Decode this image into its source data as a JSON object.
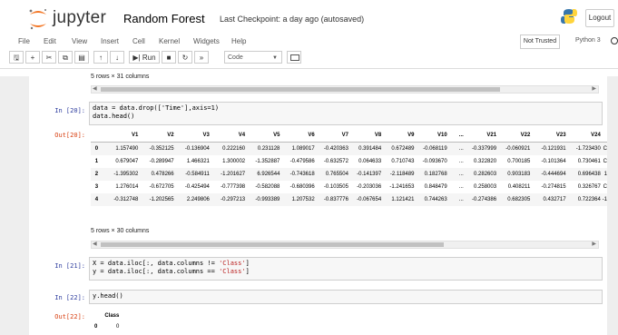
{
  "header": {
    "logo_text": "jupyter",
    "notebook_name": "Random Forest",
    "checkpoint": "Last Checkpoint: a day ago  (autosaved)",
    "logout_label": "Logout"
  },
  "menu": [
    "File",
    "Edit",
    "View",
    "Insert",
    "Cell",
    "Kernel",
    "Widgets",
    "Help"
  ],
  "status": {
    "trusted": "Not Trusted",
    "kernel": "Python 3"
  },
  "toolbar": {
    "run_label": "Run",
    "cell_type": "Code"
  },
  "cells": {
    "top_rowcount": "5 rows × 31 columns",
    "c20": {
      "prompt_in": "In [20]:",
      "code": [
        "data = data.drop(['Time'],axis=1)",
        "data.head()"
      ],
      "prompt_out": "Out[20]:"
    },
    "table": {
      "columns": [
        "",
        "V1",
        "V2",
        "V3",
        "V4",
        "V5",
        "V6",
        "V7",
        "V8",
        "V9",
        "V10",
        "...",
        "V21",
        "V22",
        "V23",
        "V24",
        ""
      ],
      "rows": [
        [
          "0",
          "1.157490",
          "-0.352125",
          "-0.136904",
          "0.222160",
          "0.231128",
          "1.089017",
          "-0.420363",
          "0.391484",
          "0.672489",
          "-0.068119",
          "...",
          "-0.337999",
          "-0.060921",
          "-0.121931",
          "-1.723430",
          "C"
        ],
        [
          "1",
          "0.679047",
          "-0.289947",
          "1.466321",
          "1.300002",
          "-1.352887",
          "-0.479586",
          "-0.632572",
          "0.064633",
          "0.710743",
          "-0.093670",
          "...",
          "0.322820",
          "0.700185",
          "-0.101364",
          "0.730461",
          "C"
        ],
        [
          "2",
          "-1.395302",
          "0.478266",
          "-0.584911",
          "-1.201627",
          "6.926544",
          "-0.743618",
          "0.765504",
          "-0.141397",
          "-2.118489",
          "0.182768",
          "...",
          "0.282603",
          "0.903183",
          "-0.444694",
          "0.696438",
          "1"
        ],
        [
          "3",
          "1.276014",
          "-0.672705",
          "-0.425494",
          "-0.777398",
          "-0.582088",
          "-0.680396",
          "-0.103505",
          "-0.203036",
          "-1.241653",
          "0.848479",
          "...",
          "0.258003",
          "0.408211",
          "-0.274815",
          "0.326767",
          "C"
        ],
        [
          "4",
          "-0.312748",
          "-1.202565",
          "2.249806",
          "-0.297213",
          "-0.993389",
          "1.207532",
          "-0.837776",
          "-0.067654",
          "1.121421",
          "0.744263",
          "...",
          "-0.274386",
          "0.682305",
          "0.432717",
          "0.722364",
          "-1"
        ]
      ]
    },
    "mid_rowcount": "5 rows × 30 columns",
    "c21": {
      "prompt_in": "In [21]:",
      "code_1a": "X = data.iloc[:, data.columns != ",
      "code_1b": "'Class'",
      "code_1c": "]",
      "code_2a": "y = data.iloc[:, data.columns == ",
      "code_2b": "'Class'",
      "code_2c": "]"
    },
    "c22": {
      "prompt_in": "In [22]:",
      "code": "y.head()",
      "prompt_out": "Out[22]:",
      "col_header": "Class",
      "row_index": "0",
      "row_value": "0"
    }
  }
}
